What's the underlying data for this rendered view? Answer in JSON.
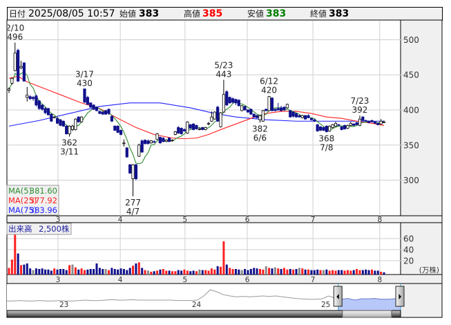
{
  "header": {
    "date_label": "日付",
    "datetime": "2025/08/05 10:57",
    "open_label": "始値",
    "open": "383",
    "high_label": "高値",
    "high": "385",
    "low_label": "安値",
    "low": "383",
    "close_label": "終値",
    "close": "383"
  },
  "legend": {
    "ma5_label": "MA(5)",
    "ma5_value": "381.60",
    "ma25_label": "MA(25)",
    "ma25_value": "377.92",
    "ma75_label": "MA(75)",
    "ma75_value": "383.96",
    "volume_label": "出来高",
    "volume_value": "2,500株"
  },
  "colors": {
    "up_body": "#ffffff",
    "down_body": "#10108c",
    "ma5": "#2e8b2e",
    "ma25": "#ff2020",
    "ma75": "#2020ff",
    "vol_up": "#ff2020",
    "vol_down": "#10108c",
    "vol_flat": "#888888",
    "high": "#ff0000",
    "low": "#008000"
  },
  "chart_data": {
    "type": "candlestick",
    "title": "",
    "price_axis": {
      "ticks": [
        "500",
        "450",
        "400",
        "350",
        "300"
      ],
      "ylim": [
        258,
        527
      ]
    },
    "month_ticks": [
      {
        "label": "3",
        "index": 16.2
      },
      {
        "label": "4",
        "index": 36.8
      },
      {
        "label": "5",
        "index": 58.2
      },
      {
        "label": "6",
        "index": 78.8
      },
      {
        "label": "7",
        "index": 100.5
      },
      {
        "label": "8",
        "index": 122.6
      }
    ],
    "candles": [
      [
        428,
        432,
        424,
        430
      ],
      [
        438,
        446,
        436,
        445
      ],
      [
        456,
        496,
        455,
        481
      ],
      [
        485,
        487,
        440,
        441
      ],
      [
        460,
        470,
        458,
        462
      ],
      [
        467,
        468,
        441,
        441
      ],
      [
        418,
        433,
        412,
        421
      ],
      [
        419,
        421,
        414,
        416
      ],
      [
        418,
        420,
        413,
        416
      ],
      [
        420,
        422,
        405,
        407
      ],
      [
        413,
        414,
        400,
        402
      ],
      [
        407,
        408,
        399,
        401
      ],
      [
        402,
        404,
        394,
        396
      ],
      [
        402,
        403,
        392,
        393
      ],
      [
        394,
        395,
        383,
        384
      ],
      [
        389,
        391,
        388,
        390
      ],
      [
        388,
        390,
        380,
        381
      ],
      [
        386,
        387,
        377,
        378
      ],
      [
        384,
        385,
        376,
        377
      ],
      [
        377,
        378,
        365,
        366
      ],
      [
        366,
        378,
        362,
        377
      ],
      [
        372,
        379,
        370,
        377
      ],
      [
        372,
        388,
        371,
        387
      ],
      [
        390,
        391,
        382,
        383
      ],
      [
        383,
        391,
        382,
        390
      ],
      [
        430,
        430,
        410,
        411
      ],
      [
        418,
        420,
        407,
        408
      ],
      [
        410,
        411,
        403,
        404
      ],
      [
        407,
        408,
        400,
        401
      ],
      [
        404,
        405,
        398,
        399
      ],
      [
        398,
        399,
        394,
        395
      ],
      [
        397,
        398,
        393,
        394
      ],
      [
        399,
        400,
        393,
        394
      ],
      [
        401,
        402,
        393,
        395
      ],
      [
        391,
        392,
        383,
        384
      ],
      [
        377,
        378,
        370,
        371
      ],
      [
        377,
        378,
        367,
        368
      ],
      [
        371,
        372,
        364,
        365
      ],
      [
        352,
        358,
        348,
        353
      ],
      [
        346,
        347,
        332,
        333
      ],
      [
        322,
        323,
        309,
        310
      ],
      [
        302,
        323,
        277,
        322
      ],
      [
        322,
        323,
        300,
        302
      ],
      [
        334,
        352,
        333,
        350
      ],
      [
        356,
        358,
        339,
        340
      ],
      [
        357,
        358,
        351,
        352
      ],
      [
        356,
        358,
        351,
        352
      ],
      [
        353,
        357,
        352,
        356
      ],
      [
        355,
        357,
        353,
        354
      ],
      [
        358,
        367,
        357,
        366
      ],
      [
        361,
        362,
        352,
        353
      ],
      [
        360,
        361,
        354,
        355
      ],
      [
        355,
        358,
        354,
        357
      ],
      [
        360,
        361,
        354,
        355
      ],
      [
        356,
        358,
        355,
        357
      ],
      [
        365,
        370,
        364,
        369
      ],
      [
        375,
        377,
        366,
        367
      ],
      [
        374,
        375,
        365,
        366
      ],
      [
        372,
        374,
        369,
        370
      ],
      [
        367,
        384,
        366,
        383
      ],
      [
        379,
        380,
        373,
        374
      ],
      [
        380,
        381,
        371,
        372
      ],
      [
        378,
        379,
        372,
        373
      ],
      [
        372,
        375,
        371,
        373
      ],
      [
        375,
        376,
        371,
        372
      ],
      [
        372,
        376,
        371,
        375
      ],
      [
        380,
        383,
        378,
        381
      ],
      [
        384,
        398,
        383,
        390
      ],
      [
        387,
        398,
        386,
        397
      ],
      [
        404,
        406,
        383,
        384
      ],
      [
        376,
        397,
        375,
        396
      ],
      [
        397,
        443,
        396,
        422
      ],
      [
        426,
        428,
        406,
        407
      ],
      [
        418,
        419,
        409,
        410
      ],
      [
        416,
        418,
        409,
        411
      ],
      [
        415,
        416,
        407,
        410
      ],
      [
        414,
        415,
        405,
        406
      ],
      [
        399,
        407,
        398,
        406
      ],
      [
        405,
        406,
        399,
        400
      ],
      [
        400,
        401,
        396,
        397
      ],
      [
        401,
        402,
        393,
        394
      ],
      [
        394,
        395,
        389,
        390
      ],
      [
        392,
        393,
        388,
        389
      ],
      [
        386,
        393,
        382,
        392
      ],
      [
        384,
        400,
        383,
        399
      ],
      [
        401,
        402,
        398,
        399
      ],
      [
        399,
        420,
        398,
        419
      ],
      [
        417,
        418,
        398,
        399
      ],
      [
        401,
        402,
        398,
        399
      ],
      [
        402,
        410,
        399,
        400
      ],
      [
        403,
        406,
        398,
        399
      ],
      [
        404,
        405,
        399,
        400
      ],
      [
        403,
        409,
        402,
        408
      ],
      [
        399,
        400,
        389,
        390
      ],
      [
        397,
        398,
        389,
        391
      ],
      [
        395,
        396,
        389,
        390
      ],
      [
        392,
        393,
        389,
        390
      ],
      [
        389,
        393,
        388,
        392
      ],
      [
        392,
        393,
        386,
        387
      ],
      [
        392,
        394,
        388,
        389
      ],
      [
        388,
        389,
        385,
        386
      ],
      [
        386,
        387,
        383,
        384
      ],
      [
        379,
        380,
        369,
        370
      ],
      [
        376,
        377,
        370,
        371
      ],
      [
        375,
        376,
        370,
        371
      ],
      [
        377,
        378,
        368,
        369
      ],
      [
        370,
        378,
        369,
        377
      ],
      [
        375,
        380,
        374,
        379
      ],
      [
        377,
        383,
        376,
        381
      ],
      [
        379,
        380,
        377,
        378
      ],
      [
        376,
        377,
        371,
        372
      ],
      [
        378,
        379,
        372,
        373
      ],
      [
        374,
        379,
        373,
        378
      ],
      [
        378,
        383,
        377,
        381
      ],
      [
        380,
        381,
        377,
        378
      ],
      [
        382,
        383,
        378,
        379
      ],
      [
        378,
        392,
        377,
        387
      ],
      [
        390,
        391,
        384,
        385
      ],
      [
        385,
        386,
        383,
        384
      ],
      [
        384,
        385,
        381,
        382
      ],
      [
        385,
        386,
        382,
        383
      ],
      [
        383,
        384,
        380,
        381
      ],
      [
        381,
        382,
        378,
        379
      ],
      [
        380,
        387,
        379,
        384
      ],
      [
        383,
        385,
        383,
        383
      ]
    ],
    "ma25": [
      [
        0,
        445
      ],
      [
        3,
        448
      ],
      [
        6,
        440
      ],
      [
        12,
        430
      ],
      [
        18,
        420
      ],
      [
        24,
        410
      ],
      [
        30,
        402
      ],
      [
        36,
        388
      ],
      [
        42,
        375
      ],
      [
        48,
        365
      ],
      [
        54,
        360
      ],
      [
        58,
        359
      ],
      [
        62,
        360
      ],
      [
        66,
        365
      ],
      [
        70,
        372
      ],
      [
        75,
        380
      ],
      [
        80,
        388
      ],
      [
        85,
        395
      ],
      [
        90,
        398
      ],
      [
        95,
        398
      ],
      [
        100,
        395
      ],
      [
        105,
        390
      ],
      [
        110,
        388
      ],
      [
        115,
        384
      ],
      [
        120,
        381
      ],
      [
        124,
        378
      ]
    ],
    "ma75": [
      [
        0,
        377
      ],
      [
        10,
        385
      ],
      [
        20,
        395
      ],
      [
        30,
        405
      ],
      [
        40,
        410
      ],
      [
        50,
        410
      ],
      [
        60,
        403
      ],
      [
        68,
        395
      ],
      [
        75,
        390
      ],
      [
        85,
        386
      ],
      [
        95,
        384
      ],
      [
        105,
        384
      ],
      [
        115,
        384
      ],
      [
        124,
        384
      ]
    ],
    "annotations": [
      {
        "index": 2,
        "date": "2/10",
        "price": "496",
        "pos": "above"
      },
      {
        "index": 25,
        "date": "3/17",
        "price": "430",
        "pos": "above"
      },
      {
        "index": 20,
        "date": "3/11",
        "price": "362",
        "pos": "below"
      },
      {
        "index": 41,
        "date": "4/7",
        "price": "277",
        "pos": "below"
      },
      {
        "index": 71,
        "date": "5/23",
        "price": "443",
        "pos": "above"
      },
      {
        "index": 86,
        "date": "6/12",
        "price": "420",
        "pos": "above"
      },
      {
        "index": 83,
        "date": "6/6",
        "price": "382",
        "pos": "below"
      },
      {
        "index": 105,
        "date": "7/8",
        "price": "368",
        "pos": "below"
      },
      {
        "index": 116,
        "date": "7/23",
        "price": "392",
        "pos": "above"
      }
    ],
    "volume": {
      "unit": "(万株)",
      "ticks": [
        "60",
        "40",
        "20"
      ],
      "values": [
        12,
        27,
        72,
        38,
        17,
        18,
        20,
        11,
        8,
        11,
        10,
        11,
        9,
        9,
        7,
        11,
        9,
        10,
        10,
        8,
        17,
        18,
        13,
        9,
        11,
        8,
        9,
        10,
        10,
        20,
        12,
        10,
        10,
        8,
        12,
        10,
        9,
        11,
        10,
        8,
        12,
        16,
        20,
        22,
        12,
        8,
        7,
        5,
        6,
        7,
        9,
        10,
        7,
        7,
        6,
        6,
        8,
        7,
        9,
        7,
        6,
        7,
        6,
        9,
        8,
        8,
        7,
        11,
        9,
        15,
        14,
        60,
        18,
        12,
        10,
        10,
        9,
        8,
        10,
        8,
        10,
        12,
        11,
        10,
        9,
        15,
        12,
        11,
        13,
        11,
        10,
        12,
        9,
        10,
        9,
        10,
        12,
        11,
        9,
        9,
        8,
        8,
        9,
        8,
        8,
        9,
        7,
        8,
        7,
        8,
        8,
        7,
        8,
        7,
        8,
        10,
        8,
        8,
        9,
        8,
        9,
        7,
        7,
        5,
        4
      ]
    },
    "navigator": {
      "values": [
        18,
        18,
        19,
        18,
        18,
        19,
        18,
        18,
        19,
        18,
        18,
        19,
        20,
        19,
        19,
        20,
        21,
        20,
        20,
        21,
        20,
        20,
        20,
        20,
        20,
        20,
        19,
        19,
        19,
        20,
        30,
        45,
        40,
        33,
        30,
        28,
        29,
        28,
        29,
        30,
        29,
        30,
        28,
        26,
        24,
        23,
        22,
        22,
        23,
        30,
        25,
        22,
        24,
        20,
        23,
        23,
        24,
        22,
        22,
        23,
        23
      ],
      "year_labels": [
        {
          "label": "23",
          "index": 8.7
        },
        {
          "label": "24",
          "index": 28.9
        },
        {
          "label": "25",
          "index": 48.6
        }
      ],
      "selected_from": 50.5
    }
  }
}
